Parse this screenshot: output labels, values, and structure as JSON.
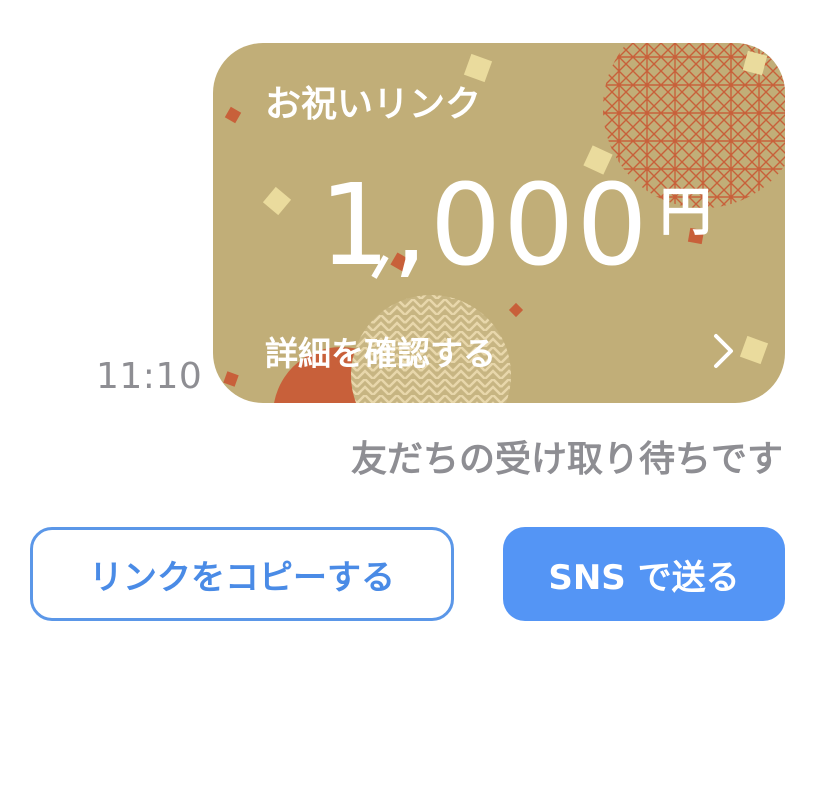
{
  "message": {
    "timestamp": "11:10",
    "status": "友だちの受け取り待ちです"
  },
  "gift_card": {
    "title": "お祝いリンク",
    "amount": "1,000",
    "currency": "円",
    "detail_link": "詳細を確認する",
    "chevron_icon": "chevron-right-icon",
    "colors": {
      "background": "#c1ae78",
      "accent_red": "#c8603a",
      "gold": "#e8d49a"
    }
  },
  "actions": {
    "copy_link": "リンクをコピーする",
    "send_sns": "SNS で送る",
    "colors": {
      "primary": "#5495f5"
    }
  }
}
